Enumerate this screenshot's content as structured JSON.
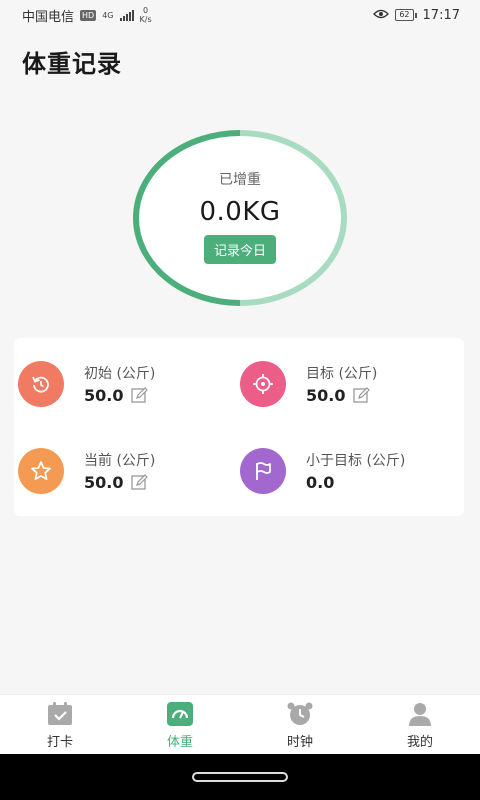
{
  "status_bar": {
    "carrier": "中国电信",
    "hd": "HD",
    "network": "4G",
    "speed_value": "0",
    "speed_unit": "K/s",
    "battery": "62",
    "time": "17:17"
  },
  "page": {
    "title": "体重记录"
  },
  "summary": {
    "label": "已增重",
    "value": "0.0KG",
    "button": "记录今日",
    "progress_fraction": 0.5
  },
  "stats": [
    {
      "label": "初始 (公斤)",
      "value": "50.0",
      "editable": true,
      "icon": "refresh-icon",
      "color": "#f07a62"
    },
    {
      "label": "目标 (公斤)",
      "value": "50.0",
      "editable": true,
      "icon": "target-icon",
      "color": "#ec5d88"
    },
    {
      "label": "当前 (公斤)",
      "value": "50.0",
      "editable": true,
      "icon": "star-icon",
      "color": "#f59a52"
    },
    {
      "label": "小于目标 (公斤)",
      "value": "0.0",
      "editable": false,
      "icon": "flag-icon",
      "color": "#a268cf"
    }
  ],
  "nav": [
    {
      "label": "打卡",
      "icon": "calendar-check-icon",
      "active": false
    },
    {
      "label": "体重",
      "icon": "scale-icon",
      "active": true
    },
    {
      "label": "时钟",
      "icon": "alarm-clock-icon",
      "active": false
    },
    {
      "label": "我的",
      "icon": "user-icon",
      "active": false
    }
  ],
  "colors": {
    "accent": "#4caf7b",
    "accent_light": "#a8dcc0",
    "nav_inactive": "#a9a9a9"
  }
}
